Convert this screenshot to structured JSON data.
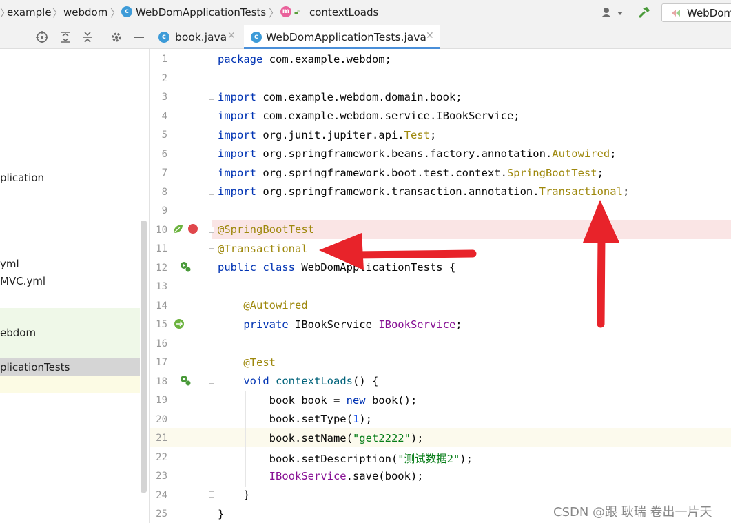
{
  "breadcrumb": {
    "items": [
      "example",
      "webdom",
      "WebDomApplicationTests",
      "contextLoads"
    ]
  },
  "run_config": {
    "label": "WebDom"
  },
  "project_tree": {
    "items": [
      {
        "label": "plication"
      },
      {
        "label": "yml"
      },
      {
        "label": "MVC.yml"
      },
      {
        "label": "ebdom"
      },
      {
        "label": "plicationTests"
      }
    ]
  },
  "tabs": [
    {
      "label": "book.java",
      "active": false
    },
    {
      "label": "WebDomApplicationTests.java",
      "active": true
    }
  ],
  "editor": {
    "line_numbers": [
      "1",
      "2",
      "3",
      "4",
      "5",
      "6",
      "7",
      "8",
      "9",
      "10",
      "11",
      "12",
      "13",
      "14",
      "15",
      "16",
      "17",
      "18",
      "19",
      "20",
      "21",
      "22",
      "23",
      "24",
      "25"
    ],
    "lines": [
      "package com.example.webdom;",
      "",
      "import com.example.webdom.domain.book;",
      "import com.example.webdom.service.IBookService;",
      "import org.junit.jupiter.api.Test;",
      "import org.springframework.beans.factory.annotation.Autowired;",
      "import org.springframework.boot.test.context.SpringBootTest;",
      "import org.springframework.transaction.annotation.Transactional;",
      "",
      "@SpringBootTest",
      "@Transactional",
      "public class WebDomApplicationTests {",
      "",
      "    @Autowired",
      "    private IBookService IBookService;",
      "",
      "    @Test",
      "    void contextLoads() {",
      "        book book = new book();",
      "        book.setType(1);",
      "        book.setName(\"get2222\");",
      "        book.setDescription(\"测试数据2\");",
      "        IBookService.save(book);",
      "    }",
      "}"
    ],
    "current_line": "21",
    "breakpoint_line": "10"
  },
  "watermark": "CSDN @跟 耿瑞 卷出一片天",
  "colors": {
    "keyword": "#0033b3",
    "annotation": "#9e880d",
    "string": "#067d17",
    "number": "#1750eb",
    "field": "#871094",
    "arrow": "#e8232a",
    "breakpoint": "#e0474c"
  }
}
